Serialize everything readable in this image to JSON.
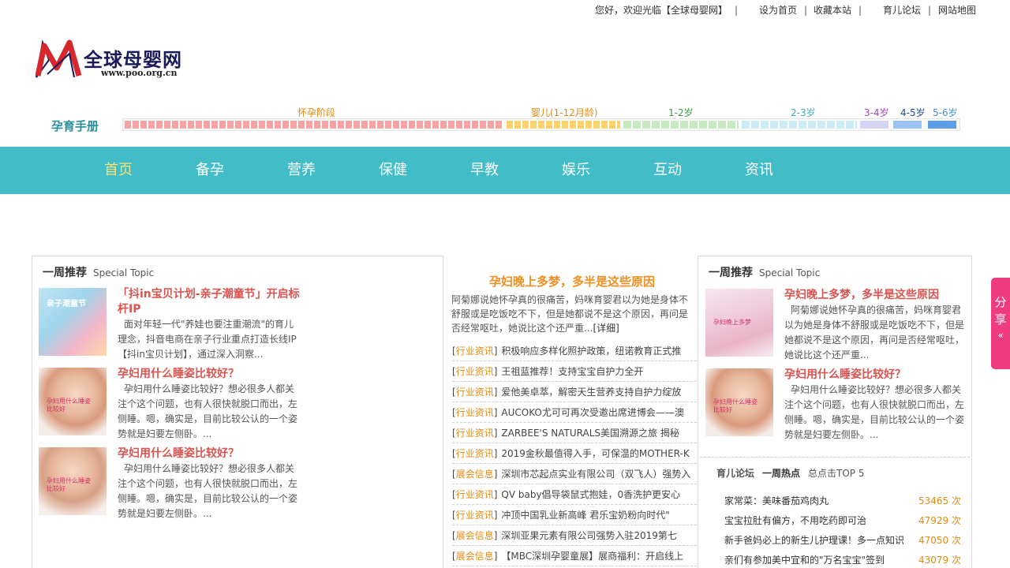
{
  "topbar": {
    "welcome": "您好，欢迎光临【全球母婴网】",
    "sep1": "|",
    "set_home": "设为首页",
    "sep2": "|",
    "bookmark": "收藏本站",
    "sep3": "|",
    "forum": "育儿论坛",
    "sep4": "|",
    "sitemap": "网站地图"
  },
  "logo": {
    "name": "全球母婴网",
    "url": "www.poo.org.cn",
    "colors": {
      "m_red": "#d7262c",
      "m_dark": "#1a1a5a"
    }
  },
  "handbook": {
    "title": "孕育手册",
    "stages": [
      {
        "label": "怀孕阶段",
        "color": "#f7a3a3",
        "text_color": "#e38a14"
      },
      {
        "label": "婴儿(1-12月龄)",
        "color": "#fcd36a",
        "text_color": "#e38a14"
      },
      {
        "label": "1-2岁",
        "color": "#c6ebc1",
        "text_color": "#3e9a44"
      },
      {
        "label": "2-3岁",
        "color": "#cbecf7",
        "text_color": "#3aa8c8"
      },
      {
        "label": "3-4岁",
        "color": "#d6d4f4",
        "text_color": "#a046b8"
      },
      {
        "label": "4-5岁",
        "color": "#9cc3f0",
        "text_color": "#1a4a8a"
      },
      {
        "label": "5-6岁",
        "color": "#5b9de6",
        "text_color": "#3a8fd8"
      }
    ]
  },
  "nav": {
    "items": [
      "首页",
      "备孕",
      "营养",
      "保健",
      "早教",
      "娱乐",
      "互动",
      "资讯"
    ],
    "active_index": 0,
    "bg_color": "#42bdc7"
  },
  "left_panel": {
    "title": "一周推荐",
    "subtitle": "Special Topic",
    "items": [
      {
        "title": "「抖in宝贝计划-亲子潮童节」开启标杆IP",
        "desc": "面对年轻一代\"养娃也要注重潮流\"的育儿理念，抖音电商在亲子行业重点打造长线IP【抖in宝贝计划】，通过深入洞察...",
        "img_text": "亲子潮童节"
      },
      {
        "title": "孕妇用什么睡姿比较好？",
        "desc": "孕妇用什么睡姿比较好？想必很多人都关注个这个问题，也有人很快就脱口而出，左侧睡。嗯，确实是，目前比较公认的一个姿势就是妇要左侧卧。...",
        "img_text": "孕妇用什么睡姿比较好"
      },
      {
        "title": "孕妇用什么睡姿比较好？",
        "desc": "孕妇用什么睡姿比较好？想必很多人都关注个这个问题，也有人很快就脱口而出，左侧睡。嗯，确实是，目前比较公认的一个姿势就是妇要左侧卧。...",
        "img_text": "孕妇用什么睡姿比较好"
      }
    ]
  },
  "center": {
    "headline": "孕妇晚上多梦，多半是这些原因",
    "summary": "阿菊娜说她怀孕真的很痛苦，妈咪育婴君以为她是身体不舒服或是吃饭吃不下，但是她都说不是这个原因，再问是否经常呕吐，她说比这个还严重...",
    "more": "[详细]",
    "news": [
      {
        "cat": "行业资讯",
        "text": "积极响应多样化照护政策，纽诺教育正式推"
      },
      {
        "cat": "行业资讯",
        "text": "王祖蓝推荐！支持宝宝自护力全开"
      },
      {
        "cat": "行业资讯",
        "text": "爱他美卓萃，解密天生营养支持自护力绽放"
      },
      {
        "cat": "行业资讯",
        "text": "AUCOKO尤可可再次受邀出席进博会——澳"
      },
      {
        "cat": "行业资讯",
        "text": "ZARBEE'S NATURALS美国溯源之旅 揭秘"
      },
      {
        "cat": "行业资讯",
        "text": "2019金秋最值得入手，可保温的MOTHER-K"
      },
      {
        "cat": "展会信息",
        "text": "深圳市芯起点实业有限公司（双飞人）强势入"
      },
      {
        "cat": "行业资讯",
        "text": "QV baby倡导袋鼠式抱娃，0香洗护更安心"
      },
      {
        "cat": "行业资讯",
        "text": "冲顶中国乳业新高峰 君乐宝奶粉向时代\""
      },
      {
        "cat": "展会信息",
        "text": "深圳亚果元素有限公司强势入驻2019第七"
      },
      {
        "cat": "展会信息",
        "text": "【MBC深圳孕婴童展】展商福利：开启线上"
      }
    ]
  },
  "right_panel": {
    "title": "一周推荐",
    "subtitle": "Special Topic",
    "items": [
      {
        "title": "孕妇晚上多梦，多半是这些原因",
        "desc": "阿菊娜说她怀孕真的很痛苦，妈咪育婴君以为她是身体不舒服或是吃饭吃不下，但是她都说不是这个原因，再问是否经常呕吐，她说比这个还严重...",
        "img_text": "孕妇晚上多梦"
      },
      {
        "title": "孕妇用什么睡姿比较好？",
        "desc": "孕妇用什么睡姿比较好？想必很多人都关注个这个问题，也有人很快就脱口而出，左侧睡。嗯，确实是，目前比较公认的一个姿势就是妇要左侧卧。...",
        "img_text": "孕妇用什么睡姿比较好"
      }
    ],
    "hot": {
      "title_green": "育儿论坛",
      "title_dark": "一周热点",
      "subtitle": "总点击TOP 5",
      "rows": [
        {
          "title": "家常菜：美味番茄鸡肉丸",
          "count": "53465 次"
        },
        {
          "title": "宝宝拉肚有偏方，不用吃药即可治",
          "count": "47929 次"
        },
        {
          "title": "新手爸妈必上的新生儿护理课！多一点知识",
          "count": "47050 次"
        },
        {
          "title": "亲们有参加美中宜和的\"万名宝宝\"签到",
          "count": "43079 次"
        }
      ]
    }
  },
  "share": {
    "label": "分享",
    "arrow": "«",
    "color": "#ef3b7f"
  }
}
